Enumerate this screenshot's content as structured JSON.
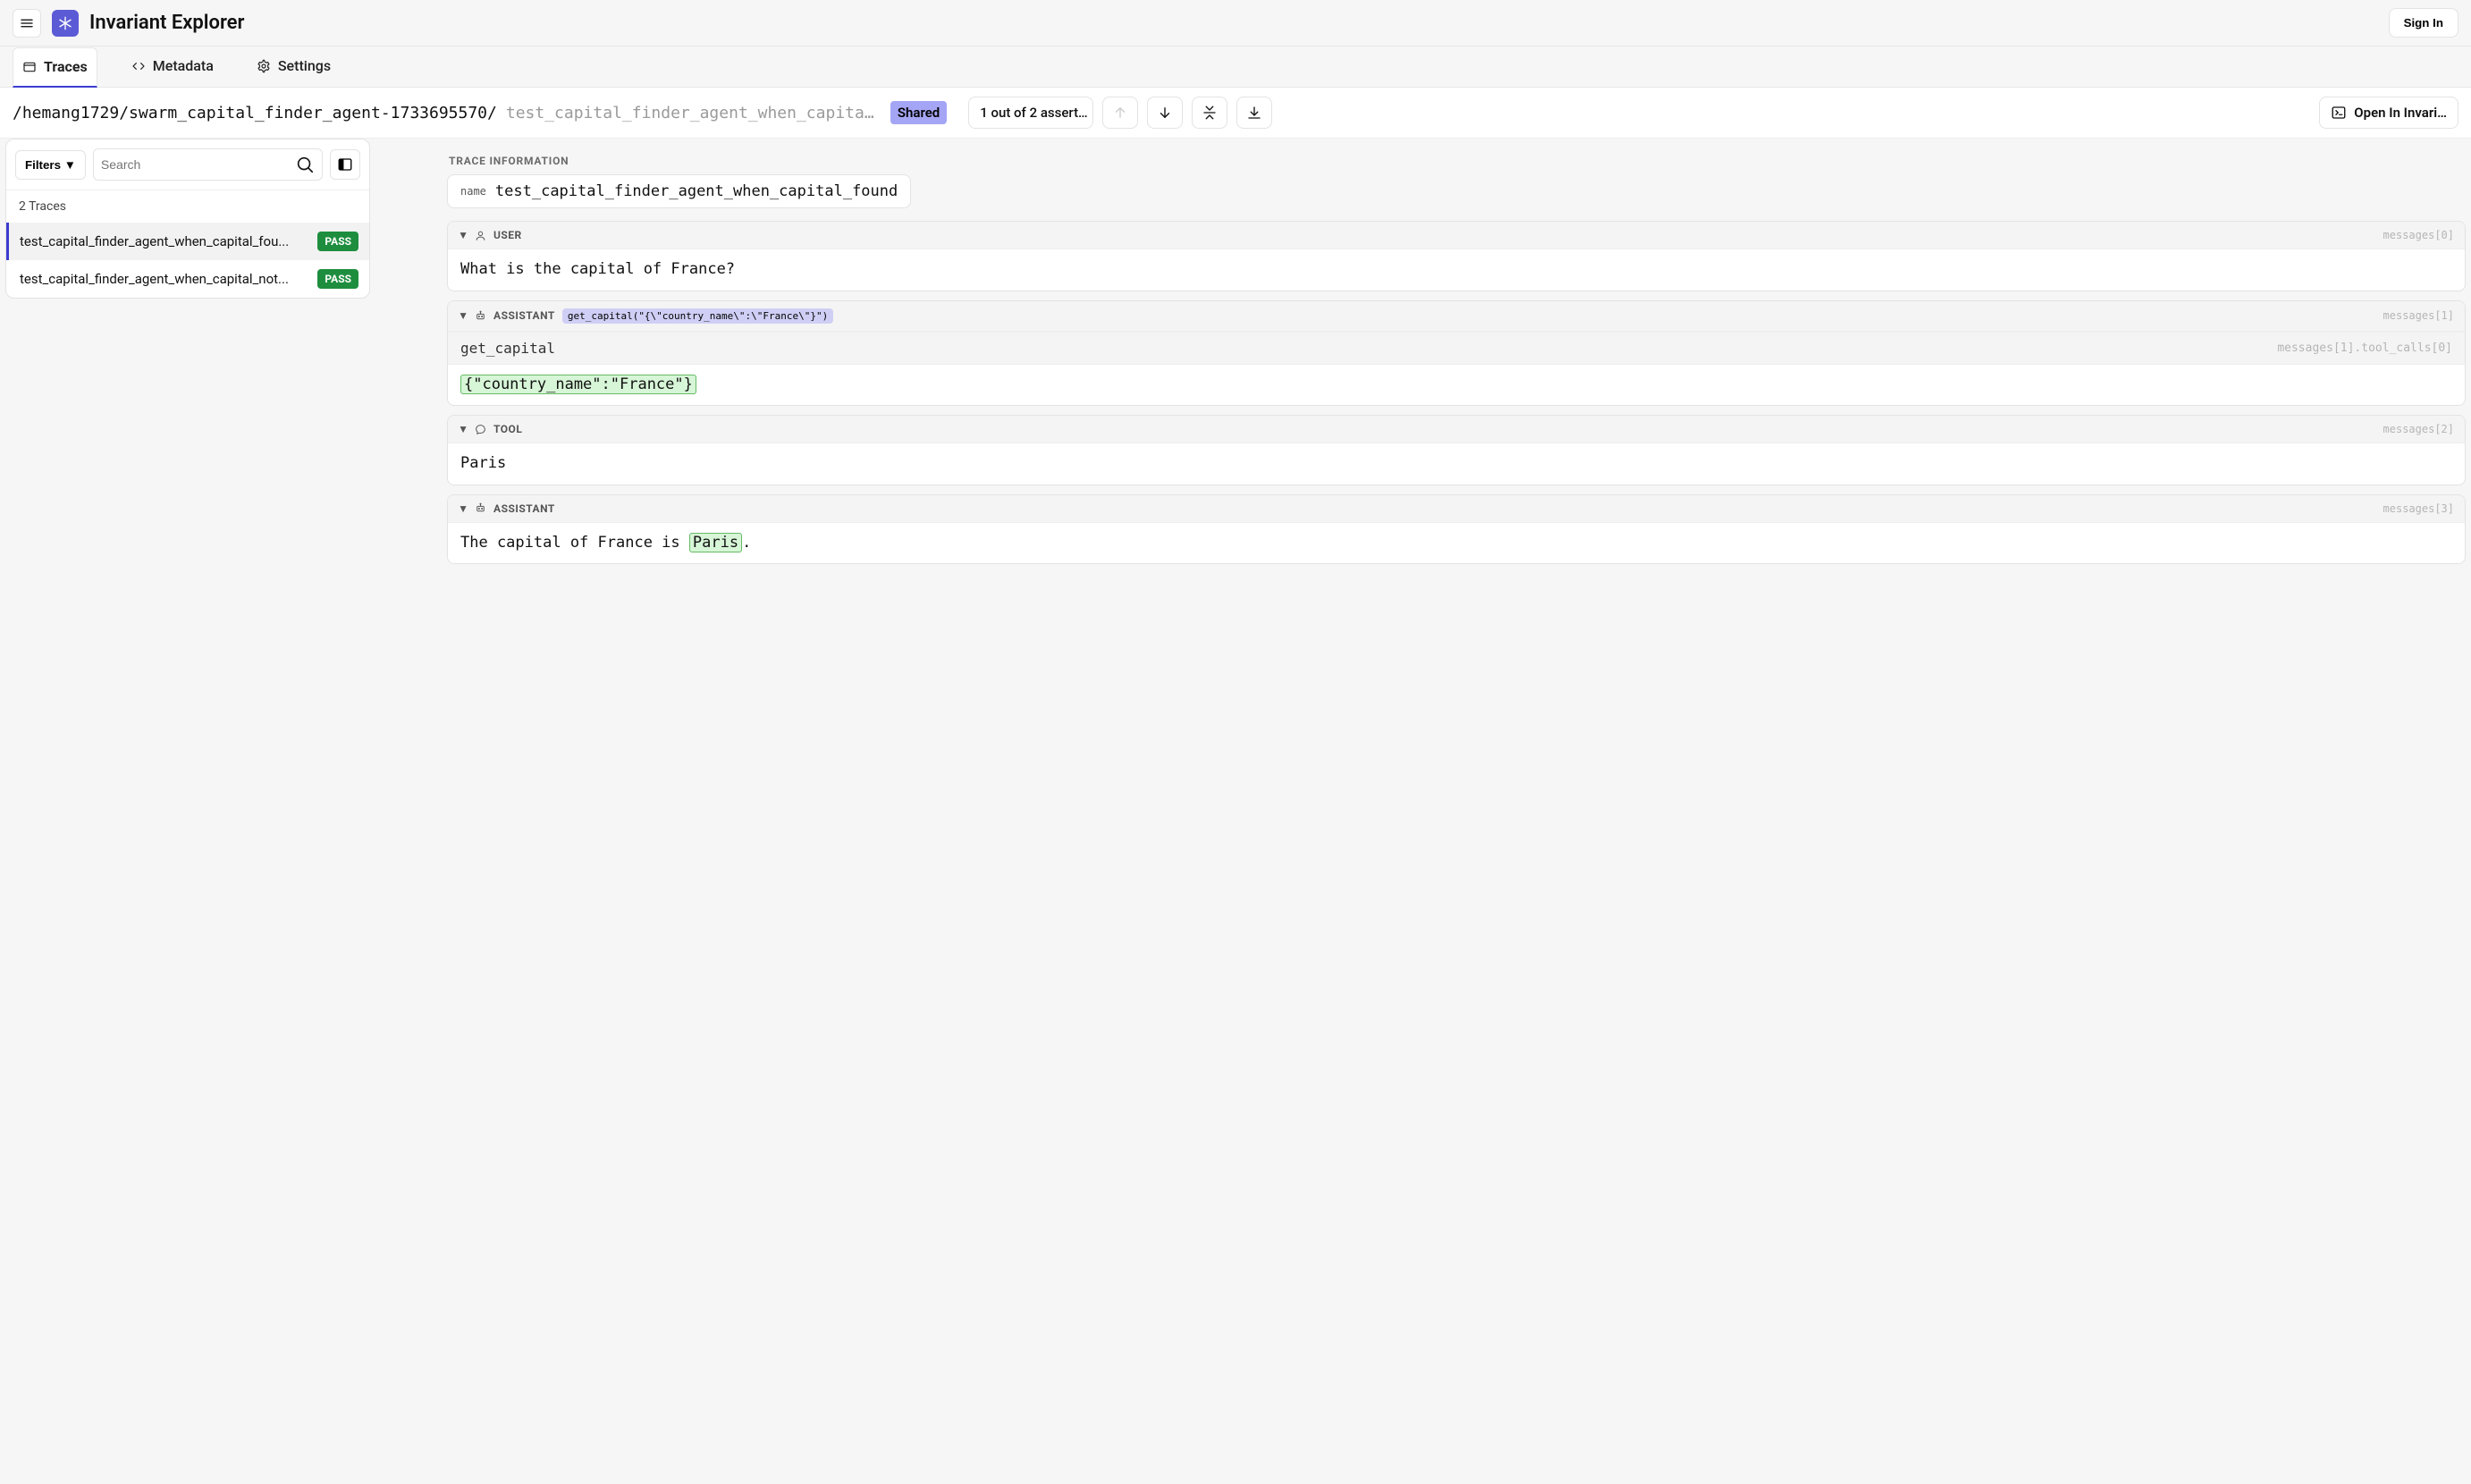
{
  "header": {
    "app_title": "Invariant Explorer",
    "signin": "Sign In"
  },
  "tabs": {
    "traces": "Traces",
    "metadata": "Metadata",
    "settings": "Settings"
  },
  "crumb": {
    "path": "/hemang1729/swarm_capital_finder_agent-1733695570/",
    "current": "test_capital_finder_agent_when_capita...",
    "shared": "Shared",
    "assertions": "1 out of 2 assert…",
    "open": "Open In Invari…"
  },
  "sidebar": {
    "filters": "Filters ▼",
    "search_placeholder": "Search",
    "count": "2 Traces",
    "items": [
      {
        "name": "test_capital_finder_agent_when_capital_fou...",
        "status": "PASS",
        "active": true
      },
      {
        "name": "test_capital_finder_agent_when_capital_not...",
        "status": "PASS",
        "active": false
      }
    ]
  },
  "main": {
    "section_label": "TRACE INFORMATION",
    "name_key": "name",
    "name_val": "test_capital_finder_agent_when_capital_found",
    "messages": [
      {
        "role": "USER",
        "idx": "messages[0]",
        "body_plain": "What is the capital of France?"
      },
      {
        "role": "ASSISTANT",
        "idx": "messages[1]",
        "call_badge": "get_capital(\"{\\\"country_name\\\":\\\"France\\\"}\")",
        "sub_fn": "get_capital",
        "sub_path": "messages[1].tool_calls[0]",
        "body_hl": "{\"country_name\":\"France\"}"
      },
      {
        "role": "TOOL",
        "idx": "messages[2]",
        "body_plain": "Paris"
      },
      {
        "role": "ASSISTANT",
        "idx": "messages[3]",
        "body_pre": "The capital of France is ",
        "body_hl": "Paris",
        "body_post": "."
      }
    ]
  }
}
